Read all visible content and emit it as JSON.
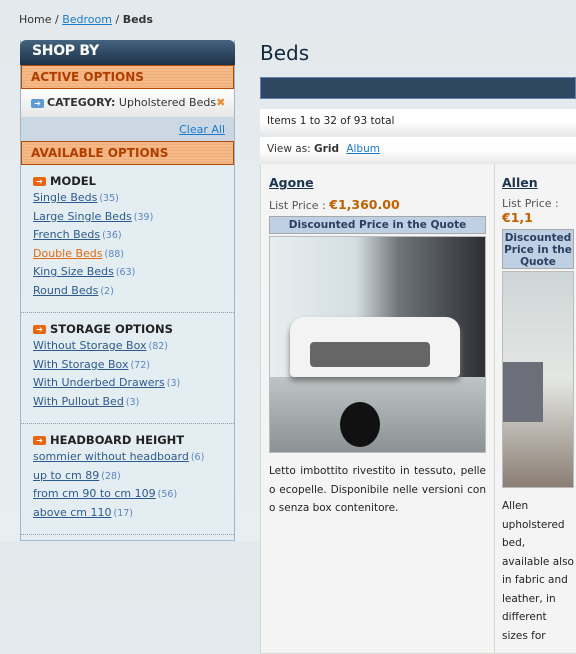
{
  "breadcrumb": {
    "home": "Home",
    "sep": "/",
    "bedroom": "Bedroom",
    "current": "Beds"
  },
  "sidebar": {
    "title": "SHOP BY",
    "active_title": "ACTIVE OPTIONS",
    "active_filter": {
      "label": "CATEGORY:",
      "value": "Upholstered Beds"
    },
    "clear_all": "Clear All",
    "available_title": "AVAILABLE OPTIONS",
    "sections": [
      {
        "title": "MODEL",
        "items": [
          {
            "label": "Single Beds",
            "count": "(35)"
          },
          {
            "label": "Large Single Beds",
            "count": "(39)"
          },
          {
            "label": "French Beds",
            "count": "(36)"
          },
          {
            "label": "Double Beds",
            "count": "(88)",
            "active": true
          },
          {
            "label": "King Size Beds",
            "count": "(63)"
          },
          {
            "label": "Round Beds",
            "count": "(2)"
          }
        ]
      },
      {
        "title": "STORAGE OPTIONS",
        "items": [
          {
            "label": "Without Storage Box",
            "count": "(82)"
          },
          {
            "label": "With Storage Box",
            "count": "(72)"
          },
          {
            "label": "With Underbed Drawers",
            "count": "(3)"
          },
          {
            "label": "With Pullout Bed",
            "count": "(3)"
          }
        ]
      },
      {
        "title": "HEADBOARD HEIGHT",
        "items": [
          {
            "label": "sommier without headboard",
            "count": "(6)"
          },
          {
            "label": "up to cm 89",
            "count": "(28)"
          },
          {
            "label": "from cm 90 to cm 109",
            "count": "(56)"
          },
          {
            "label": "above cm 110",
            "count": "(17)"
          }
        ]
      }
    ]
  },
  "main": {
    "title": "Beds",
    "pager": "Items 1 to 32 of 93 total",
    "view_as": "View as:",
    "view_grid": "Grid",
    "view_album": "Album",
    "products": [
      {
        "name": "Agone",
        "price_label": "List Price :",
        "price": "€1,360.00",
        "badge": "Discounted Price in the Quote",
        "description": "Letto imbottito rivestito in tessuto, pelle o ecopelle. Disponibile nelle versioni con o senza box contenitore."
      },
      {
        "name": "Allen",
        "price_label": "List Price :",
        "price": "€1,1",
        "badge": "Discounted Price in the Quote",
        "description": "Allen upholstered bed, available also in fabric and leather, in different sizes for"
      }
    ]
  },
  "colors": {
    "header": "#2f4760",
    "accent": "#c06000",
    "option_header": "#f5b887"
  }
}
